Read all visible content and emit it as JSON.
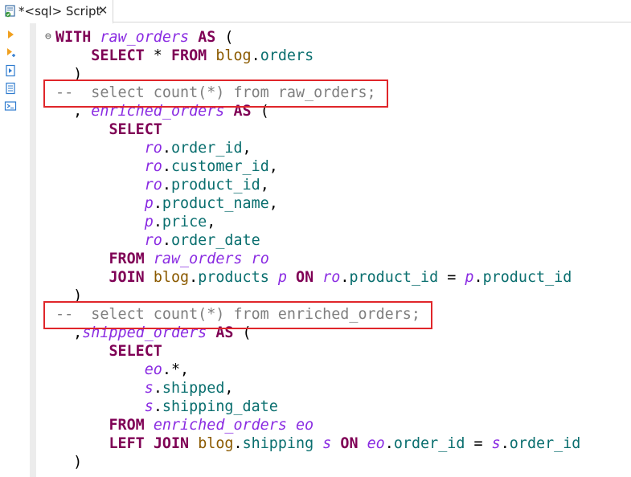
{
  "tab": {
    "title": "*<sql> Script",
    "close_glyph": "✕",
    "icon": "sql-script-icon"
  },
  "ruler_icons": [
    "execute-statement-icon",
    "execute-statement-new-tab-icon",
    "execute-script-icon",
    "explain-plan-icon",
    "load-script-icon"
  ],
  "colors": {
    "keyword": "#7f0055",
    "cte_name": "#8a2be2",
    "table": "#8b5a00",
    "column": "#0a6f6f",
    "comment": "#7f7f7f",
    "highlight_box": "#e0262a"
  },
  "code_lines": [
    [
      {
        "t": "WITH",
        "c": "kw"
      },
      {
        "t": " ",
        "c": "plain"
      },
      {
        "t": "raw_orders",
        "c": "cte"
      },
      {
        "t": " ",
        "c": "plain"
      },
      {
        "t": "AS",
        "c": "kw"
      },
      {
        "t": " (",
        "c": "plain"
      }
    ],
    [
      {
        "t": "    ",
        "c": "plain"
      },
      {
        "t": "SELECT",
        "c": "kw"
      },
      {
        "t": " * ",
        "c": "plain"
      },
      {
        "t": "FROM",
        "c": "kw"
      },
      {
        "t": " ",
        "c": "plain"
      },
      {
        "t": "blog",
        "c": "tbl"
      },
      {
        "t": ".",
        "c": "plain"
      },
      {
        "t": "orders",
        "c": "col"
      }
    ],
    [
      {
        "t": "  )",
        "c": "plain"
      }
    ],
    [
      {
        "t": "--  select count(*) from raw_orders;",
        "c": "cmt"
      }
    ],
    [
      {
        "t": "  , ",
        "c": "plain"
      },
      {
        "t": "enriched_orders",
        "c": "cte"
      },
      {
        "t": " ",
        "c": "plain"
      },
      {
        "t": "AS",
        "c": "kw"
      },
      {
        "t": " (",
        "c": "plain"
      }
    ],
    [
      {
        "t": "      ",
        "c": "plain"
      },
      {
        "t": "SELECT",
        "c": "kw"
      }
    ],
    [
      {
        "t": "          ",
        "c": "plain"
      },
      {
        "t": "ro",
        "c": "alias"
      },
      {
        "t": ".",
        "c": "plain"
      },
      {
        "t": "order_id",
        "c": "col"
      },
      {
        "t": ",",
        "c": "plain"
      }
    ],
    [
      {
        "t": "          ",
        "c": "plain"
      },
      {
        "t": "ro",
        "c": "alias"
      },
      {
        "t": ".",
        "c": "plain"
      },
      {
        "t": "customer_id",
        "c": "col"
      },
      {
        "t": ",",
        "c": "plain"
      }
    ],
    [
      {
        "t": "          ",
        "c": "plain"
      },
      {
        "t": "ro",
        "c": "alias"
      },
      {
        "t": ".",
        "c": "plain"
      },
      {
        "t": "product_id",
        "c": "col"
      },
      {
        "t": ",",
        "c": "plain"
      }
    ],
    [
      {
        "t": "          ",
        "c": "plain"
      },
      {
        "t": "p",
        "c": "alias"
      },
      {
        "t": ".",
        "c": "plain"
      },
      {
        "t": "product_name",
        "c": "col"
      },
      {
        "t": ",",
        "c": "plain"
      }
    ],
    [
      {
        "t": "          ",
        "c": "plain"
      },
      {
        "t": "p",
        "c": "alias"
      },
      {
        "t": ".",
        "c": "plain"
      },
      {
        "t": "price",
        "c": "col"
      },
      {
        "t": ",",
        "c": "plain"
      }
    ],
    [
      {
        "t": "          ",
        "c": "plain"
      },
      {
        "t": "ro",
        "c": "alias"
      },
      {
        "t": ".",
        "c": "plain"
      },
      {
        "t": "order_date",
        "c": "col"
      }
    ],
    [
      {
        "t": "      ",
        "c": "plain"
      },
      {
        "t": "FROM",
        "c": "kw"
      },
      {
        "t": " ",
        "c": "plain"
      },
      {
        "t": "raw_orders",
        "c": "cte"
      },
      {
        "t": " ",
        "c": "plain"
      },
      {
        "t": "ro",
        "c": "alias"
      }
    ],
    [
      {
        "t": "      ",
        "c": "plain"
      },
      {
        "t": "JOIN",
        "c": "kw"
      },
      {
        "t": " ",
        "c": "plain"
      },
      {
        "t": "blog",
        "c": "tbl"
      },
      {
        "t": ".",
        "c": "plain"
      },
      {
        "t": "products",
        "c": "col"
      },
      {
        "t": " ",
        "c": "plain"
      },
      {
        "t": "p",
        "c": "alias"
      },
      {
        "t": " ",
        "c": "plain"
      },
      {
        "t": "ON",
        "c": "kw"
      },
      {
        "t": " ",
        "c": "plain"
      },
      {
        "t": "ro",
        "c": "alias"
      },
      {
        "t": ".",
        "c": "plain"
      },
      {
        "t": "product_id",
        "c": "col"
      },
      {
        "t": " = ",
        "c": "plain"
      },
      {
        "t": "p",
        "c": "alias"
      },
      {
        "t": ".",
        "c": "plain"
      },
      {
        "t": "product_id",
        "c": "col"
      }
    ],
    [
      {
        "t": "  )",
        "c": "plain"
      }
    ],
    [
      {
        "t": "--  select count(*) from enriched_orders;",
        "c": "cmt"
      }
    ],
    [
      {
        "t": "  ,",
        "c": "plain"
      },
      {
        "t": "shipped_orders",
        "c": "cte"
      },
      {
        "t": " ",
        "c": "plain"
      },
      {
        "t": "AS",
        "c": "kw"
      },
      {
        "t": " (",
        "c": "plain"
      }
    ],
    [
      {
        "t": "      ",
        "c": "plain"
      },
      {
        "t": "SELECT",
        "c": "kw"
      }
    ],
    [
      {
        "t": "          ",
        "c": "plain"
      },
      {
        "t": "eo",
        "c": "alias"
      },
      {
        "t": ".*,",
        "c": "plain"
      }
    ],
    [
      {
        "t": "          ",
        "c": "plain"
      },
      {
        "t": "s",
        "c": "alias"
      },
      {
        "t": ".",
        "c": "plain"
      },
      {
        "t": "shipped",
        "c": "col"
      },
      {
        "t": ",",
        "c": "plain"
      }
    ],
    [
      {
        "t": "          ",
        "c": "plain"
      },
      {
        "t": "s",
        "c": "alias"
      },
      {
        "t": ".",
        "c": "plain"
      },
      {
        "t": "shipping_date",
        "c": "col"
      }
    ],
    [
      {
        "t": "      ",
        "c": "plain"
      },
      {
        "t": "FROM",
        "c": "kw"
      },
      {
        "t": " ",
        "c": "plain"
      },
      {
        "t": "enriched_orders",
        "c": "cte"
      },
      {
        "t": " ",
        "c": "plain"
      },
      {
        "t": "eo",
        "c": "alias"
      }
    ],
    [
      {
        "t": "      ",
        "c": "plain"
      },
      {
        "t": "LEFT",
        "c": "kw"
      },
      {
        "t": " ",
        "c": "plain"
      },
      {
        "t": "JOIN",
        "c": "kw"
      },
      {
        "t": " ",
        "c": "plain"
      },
      {
        "t": "blog",
        "c": "tbl"
      },
      {
        "t": ".",
        "c": "plain"
      },
      {
        "t": "shipping",
        "c": "col"
      },
      {
        "t": " ",
        "c": "plain"
      },
      {
        "t": "s",
        "c": "alias"
      },
      {
        "t": " ",
        "c": "plain"
      },
      {
        "t": "ON",
        "c": "kw"
      },
      {
        "t": " ",
        "c": "plain"
      },
      {
        "t": "eo",
        "c": "alias"
      },
      {
        "t": ".",
        "c": "plain"
      },
      {
        "t": "order_id",
        "c": "col"
      },
      {
        "t": " = ",
        "c": "plain"
      },
      {
        "t": "s",
        "c": "alias"
      },
      {
        "t": ".",
        "c": "plain"
      },
      {
        "t": "order_id",
        "c": "col"
      }
    ],
    [
      {
        "t": "  )",
        "c": "plain"
      }
    ]
  ],
  "fold_marker": "⊖",
  "highlighted_lines": [
    3,
    15
  ]
}
